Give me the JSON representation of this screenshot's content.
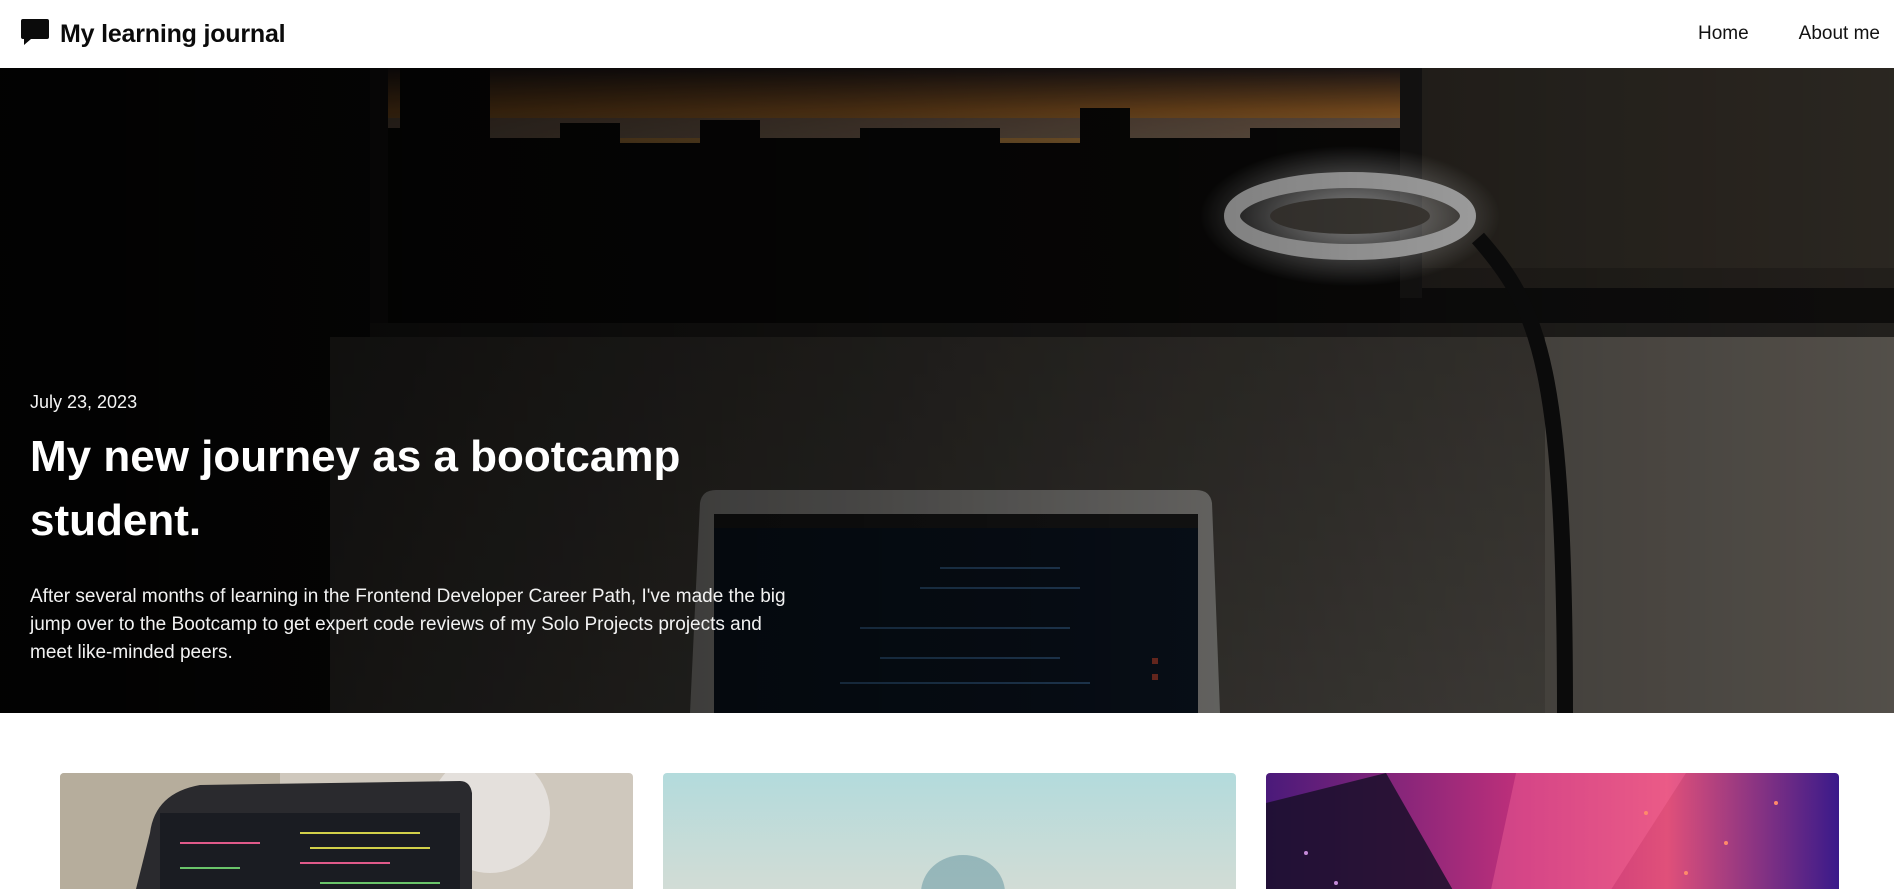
{
  "header": {
    "brand_title": "My learning journal",
    "brand_icon": "chat-bubble-icon",
    "nav": [
      {
        "label": "Home"
      },
      {
        "label": "About me"
      }
    ]
  },
  "hero": {
    "date": "July 23, 2023",
    "title": "My new journey as a bootcamp student.",
    "excerpt": "After several months of learning in the Frontend Developer Career Path, I've made the big jump over to the Bootcamp to get expert code reviews of my Solo Projects projects and meet like-minded peers."
  },
  "colors": {
    "text_dark": "#0b0b0b",
    "hero_text": "#ffffff"
  }
}
